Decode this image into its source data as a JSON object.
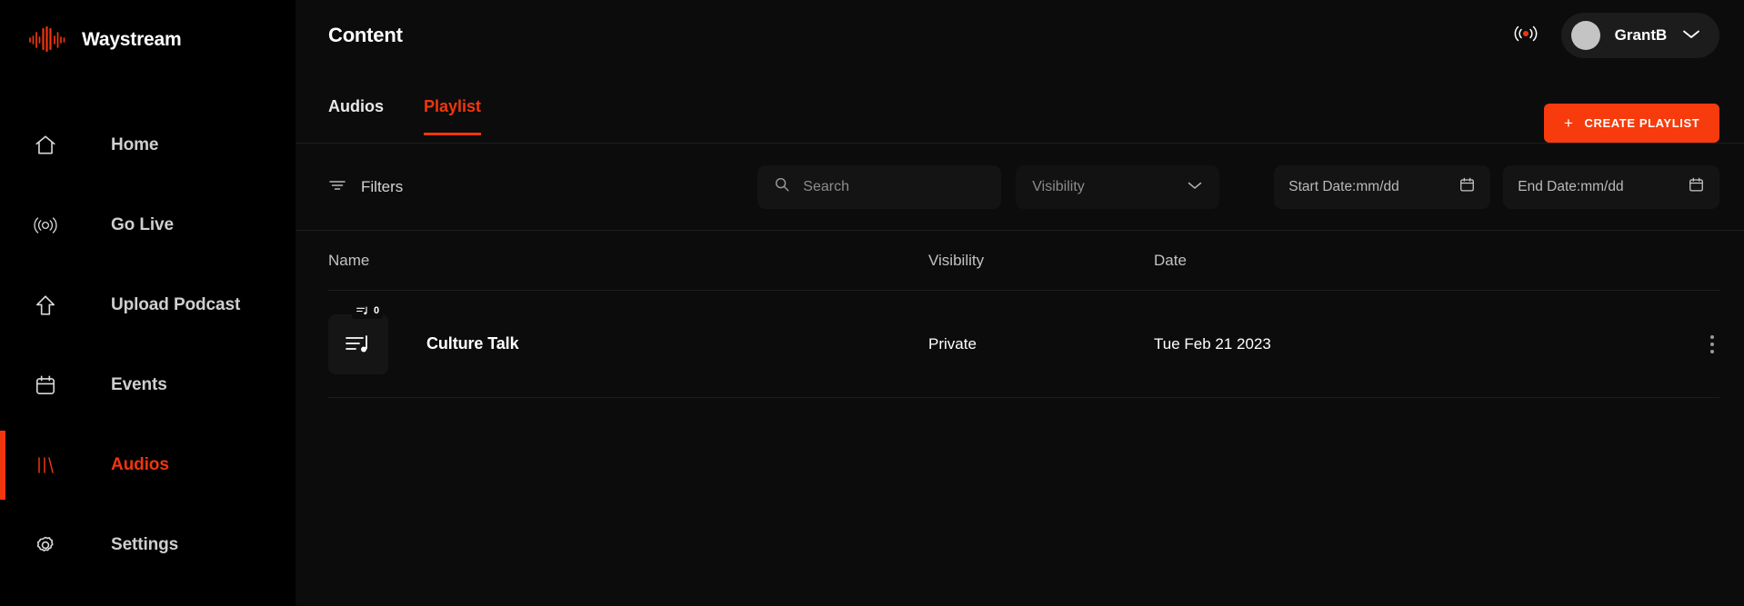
{
  "brand": {
    "name": "Waystream",
    "logo_icon": "waveform-icon",
    "accent": "#f0360d"
  },
  "sidebar": {
    "items": [
      {
        "label": "Home",
        "icon": "home-icon",
        "active": false
      },
      {
        "label": "Go Live",
        "icon": "broadcast-icon",
        "active": false
      },
      {
        "label": "Upload Podcast",
        "icon": "upload-icon",
        "active": false
      },
      {
        "label": "Events",
        "icon": "calendar-icon",
        "active": false
      },
      {
        "label": "Audios",
        "icon": "audio-bars-icon",
        "active": true
      },
      {
        "label": "Settings",
        "icon": "gear-icon",
        "active": false
      }
    ]
  },
  "header": {
    "title": "Content",
    "live_icon": "live-broadcast-icon",
    "user": {
      "name": "GrantB",
      "avatar_icon": "avatar",
      "chevron_icon": "chevron-down-icon"
    }
  },
  "tabs": [
    {
      "label": "Audios",
      "active": false
    },
    {
      "label": "Playlist",
      "active": true
    }
  ],
  "actions": {
    "create_playlist_label": "CREATE  PLAYLIST",
    "plus_icon": "plus-icon",
    "create_color": "#f73b0c"
  },
  "filters": {
    "label": "Filters",
    "filter_icon": "filter-icon",
    "search": {
      "placeholder": "Search",
      "value": "",
      "icon": "search-icon"
    },
    "visibility": {
      "label": "Visibility",
      "icon": "chevron-down-icon"
    },
    "start_date": {
      "text": "Start Date:mm/dd",
      "icon": "calendar-icon"
    },
    "end_date": {
      "text": "End Date:mm/dd",
      "icon": "calendar-icon"
    }
  },
  "table": {
    "columns": {
      "name": "Name",
      "visibility": "Visibility",
      "date": "Date"
    },
    "rows": [
      {
        "title": "Culture Talk",
        "visibility": "Private",
        "date": "Tue Feb 21 2023",
        "badge_count": "0",
        "thumb_icon": "playlist-music-icon",
        "menu_icon": "more-vertical-icon"
      }
    ]
  }
}
